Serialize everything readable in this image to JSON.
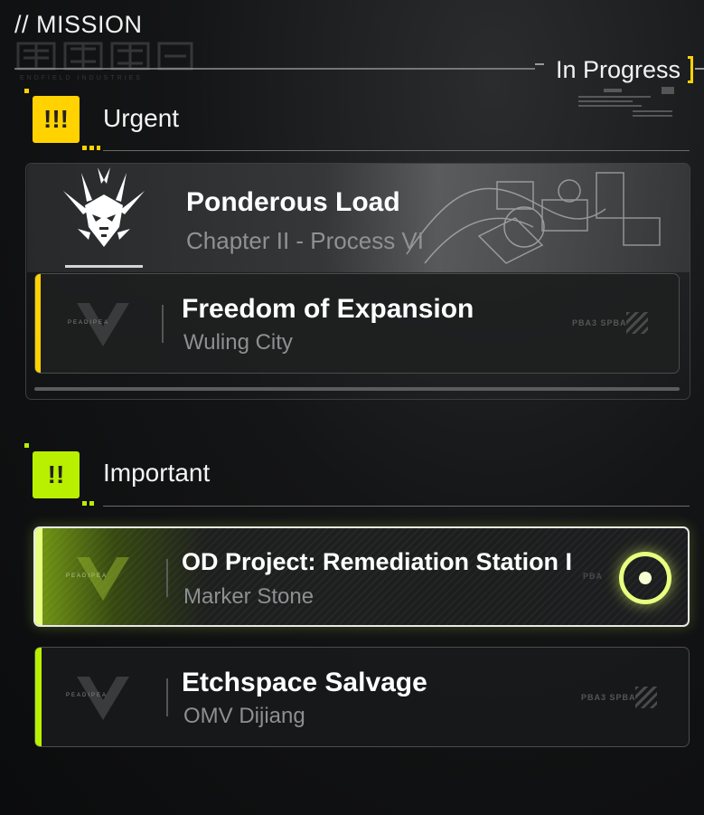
{
  "header": {
    "title": "// MISSION",
    "status": "In Progress",
    "brand_sub": "ENDFIELD INDUSTRIES"
  },
  "colors": {
    "urgent": "#ffd200",
    "important": "#b8f000",
    "background": "#141516"
  },
  "categories": [
    {
      "label": "Urgent",
      "badge": "!!!",
      "missions": [
        {
          "title": "Ponderous Load",
          "subtitle": "Chapter II - Process VI",
          "emblem": "dragon-skull-icon"
        },
        {
          "title": "Freedom of Expansion",
          "subtitle": "Wuling City",
          "faction": "PEADIPEA",
          "tag": "PBA3 SPBA"
        }
      ]
    },
    {
      "label": "Important",
      "badge": "!!",
      "missions": [
        {
          "title": "OD Project: Remediation Station I",
          "subtitle": "Marker Stone",
          "faction": "PEADIPEA",
          "tag": "PBA",
          "selected": true,
          "tracking_icon": "target-icon"
        },
        {
          "title": "Etchspace Salvage",
          "subtitle": "OMV Dijiang",
          "faction": "PEADIPEA",
          "tag": "PBA3 SPBA"
        }
      ]
    }
  ]
}
